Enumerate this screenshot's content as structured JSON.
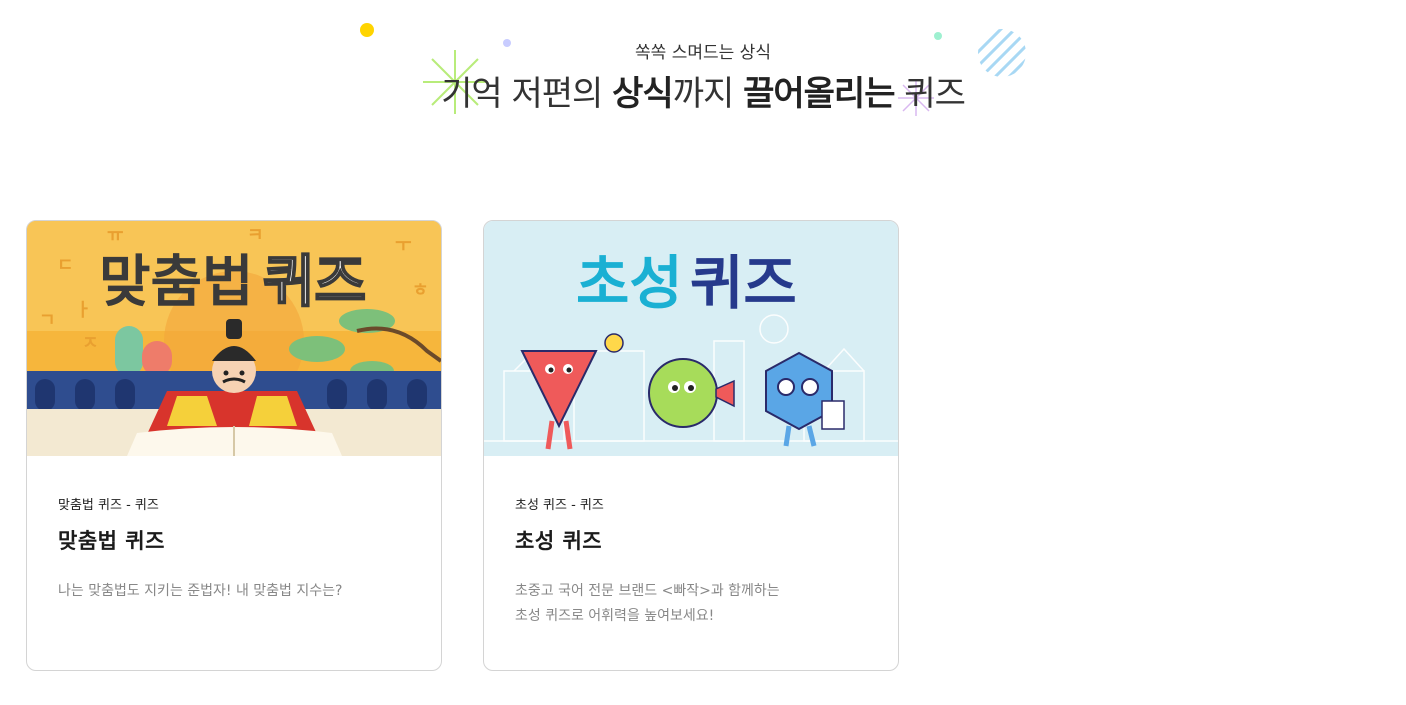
{
  "hero": {
    "subtitle": "쏙쏙 스며드는 상식",
    "title_parts": [
      "기억 저편의 ",
      "상식",
      "까지 ",
      "끌어올리는",
      " 퀴즈"
    ]
  },
  "cards": [
    {
      "thumbnail_text": [
        "맞춤법",
        "퀴즈"
      ],
      "category": "맞춤법 퀴즈 - 퀴즈",
      "title": "맞춤법 퀴즈",
      "description": [
        "나는 맞춤법도 지키는 준법자! 내 맞춤법 지수는?"
      ]
    },
    {
      "thumbnail_text": [
        "초성",
        "퀴즈"
      ],
      "category": "초성 퀴즈 - 퀴즈",
      "title": "초성 퀴즈",
      "description": [
        "초중고 국어 전문 브랜드 <빠작>과 함께하는",
        "초성 퀴즈로 어휘력을 높여보세요!"
      ]
    }
  ],
  "colors": {
    "card1_bg": "#f6b63c",
    "card1_roof": "#2f4d8f",
    "card2_bg": "#d8eef4",
    "card2_title_1": "#1ab0d3",
    "card2_title_2": "#263a8c",
    "desc_text": "#888888"
  }
}
